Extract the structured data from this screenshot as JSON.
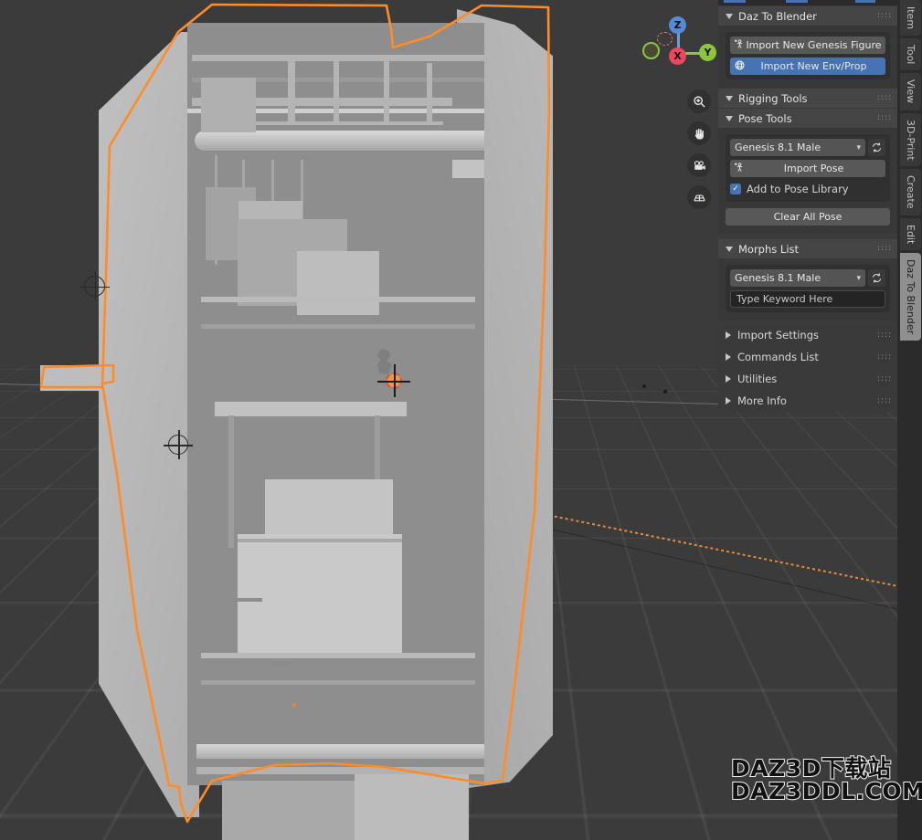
{
  "app": {
    "name": "Blender 3D Viewport",
    "viewport_shading": "solid"
  },
  "nav_gizmo": {
    "axes": [
      {
        "name": "X",
        "label": "X",
        "color": "#eb4860"
      },
      {
        "name": "Y",
        "label": "Y",
        "color": "#8cc63f"
      },
      {
        "name": "Z",
        "label": "Z",
        "color": "#5689d6"
      }
    ],
    "negative_axis_labels": [
      "",
      "",
      ""
    ]
  },
  "viewport_tools": [
    {
      "name": "zoom-tool",
      "icon": "magnifier-plus-icon",
      "glyph": "⊕"
    },
    {
      "name": "pan-tool",
      "icon": "hand-icon",
      "glyph": "✋"
    },
    {
      "name": "camera-tool",
      "icon": "camera-icon",
      "glyph": "🎥"
    },
    {
      "name": "grid-tool",
      "icon": "grid-icon",
      "glyph": "▦"
    }
  ],
  "side_panel": {
    "sections": [
      {
        "id": "daz-to-blender",
        "title": "Daz To Blender",
        "expanded": true,
        "buttons": [
          {
            "label": "Import New Genesis Figure",
            "icon": "armature-pose-icon",
            "active": false
          },
          {
            "label": "Import New Env/Prop",
            "icon": "globe-icon",
            "active": true
          }
        ]
      },
      {
        "id": "rigging-tools",
        "title": "Rigging Tools",
        "expanded": true
      },
      {
        "id": "pose-tools",
        "title": "Pose Tools",
        "expanded": true,
        "figure_dropdown": {
          "value": "Genesis 8.1 Male",
          "refresh_icon": "refresh-icon"
        },
        "import_pose_button": {
          "label": "Import Pose",
          "icon": "armature-pose-icon"
        },
        "add_to_pose_library": {
          "label": "Add to Pose Library",
          "checked": true
        },
        "clear_all_pose_button": {
          "label": "Clear All Pose"
        }
      },
      {
        "id": "morphs-list",
        "title": "Morphs List",
        "expanded": true,
        "figure_dropdown": {
          "value": "Genesis 8.1 Male",
          "refresh_icon": "refresh-icon"
        },
        "keyword_field": {
          "value": "Type Keyword Here",
          "placeholder": "Type Keyword Here"
        }
      }
    ],
    "collapsed_sections": [
      {
        "id": "import-settings",
        "title": "Import Settings"
      },
      {
        "id": "commands-list",
        "title": "Commands List"
      },
      {
        "id": "utilities",
        "title": "Utilities"
      },
      {
        "id": "more-info",
        "title": "More Info"
      }
    ]
  },
  "tab_rail": {
    "tabs": [
      {
        "label": "Item",
        "active": false
      },
      {
        "label": "Tool",
        "active": false
      },
      {
        "label": "View",
        "active": false
      },
      {
        "label": "3D-Print",
        "active": false
      },
      {
        "label": "Create",
        "active": false
      },
      {
        "label": "Edit",
        "active": false
      },
      {
        "label": "Daz To Blender",
        "active": true
      }
    ]
  },
  "watermark": {
    "line1": "DAZ3D下载站",
    "line2": "DAZ3DDL.COM"
  },
  "colors": {
    "selection_outline": "#ff8c28",
    "accent_blue": "#4772b3",
    "panel_bg": "#383838",
    "header_bg": "#454545",
    "viewport_bg": "#3b3b3b",
    "axis_x": "#eb4860",
    "axis_y": "#8cc63f",
    "axis_z": "#5689d6"
  }
}
